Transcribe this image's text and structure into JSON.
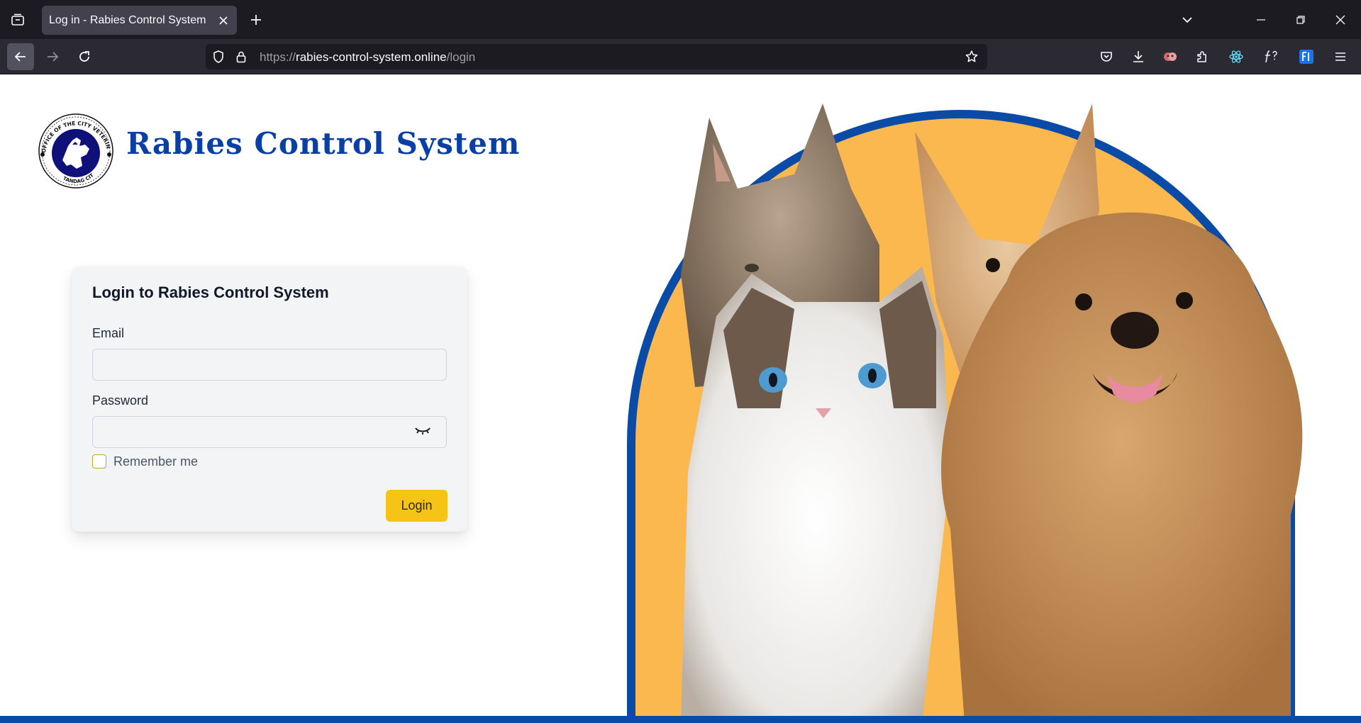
{
  "browser": {
    "tab_title": "Log in - Rabies Control System",
    "url_prefix": "https://",
    "url_host": "rabies-control-system.online",
    "url_path": "/login"
  },
  "icons": {
    "tab_list": "tab-list-icon",
    "tab_close": "close-icon",
    "new_tab": "plus-icon",
    "list_all_tabs": "chevron-down-icon",
    "minimize": "minimize-icon",
    "restore": "restore-icon",
    "close_window": "close-icon",
    "back": "back-arrow-icon",
    "forward": "forward-arrow-icon",
    "reload": "reload-icon",
    "shield": "shield-icon",
    "lock": "lock-icon",
    "bookmark": "star-icon",
    "pocket": "pocket-icon",
    "downloads": "download-icon",
    "extensions": "puzzle-icon",
    "menu": "hamburger-icon",
    "password_toggle": "eye-closed-icon"
  },
  "page": {
    "brand_title": "Rabies Control System",
    "logo_text_top": "OFFICE OF THE CITY VETERINARIAN",
    "logo_text_bottom": "TANDAG CITY",
    "login": {
      "heading": "Login to Rabies Control System",
      "email_label": "Email",
      "email_value": "",
      "password_label": "Password",
      "password_value": "",
      "remember_label": "Remember me",
      "remember_checked": false,
      "submit_label": "Login"
    }
  },
  "colors": {
    "brand_blue": "#0a3fa6",
    "accent_yellow": "#f6c416",
    "hero_orange": "#fbb84f",
    "arch_blue": "#0a4ba8"
  }
}
